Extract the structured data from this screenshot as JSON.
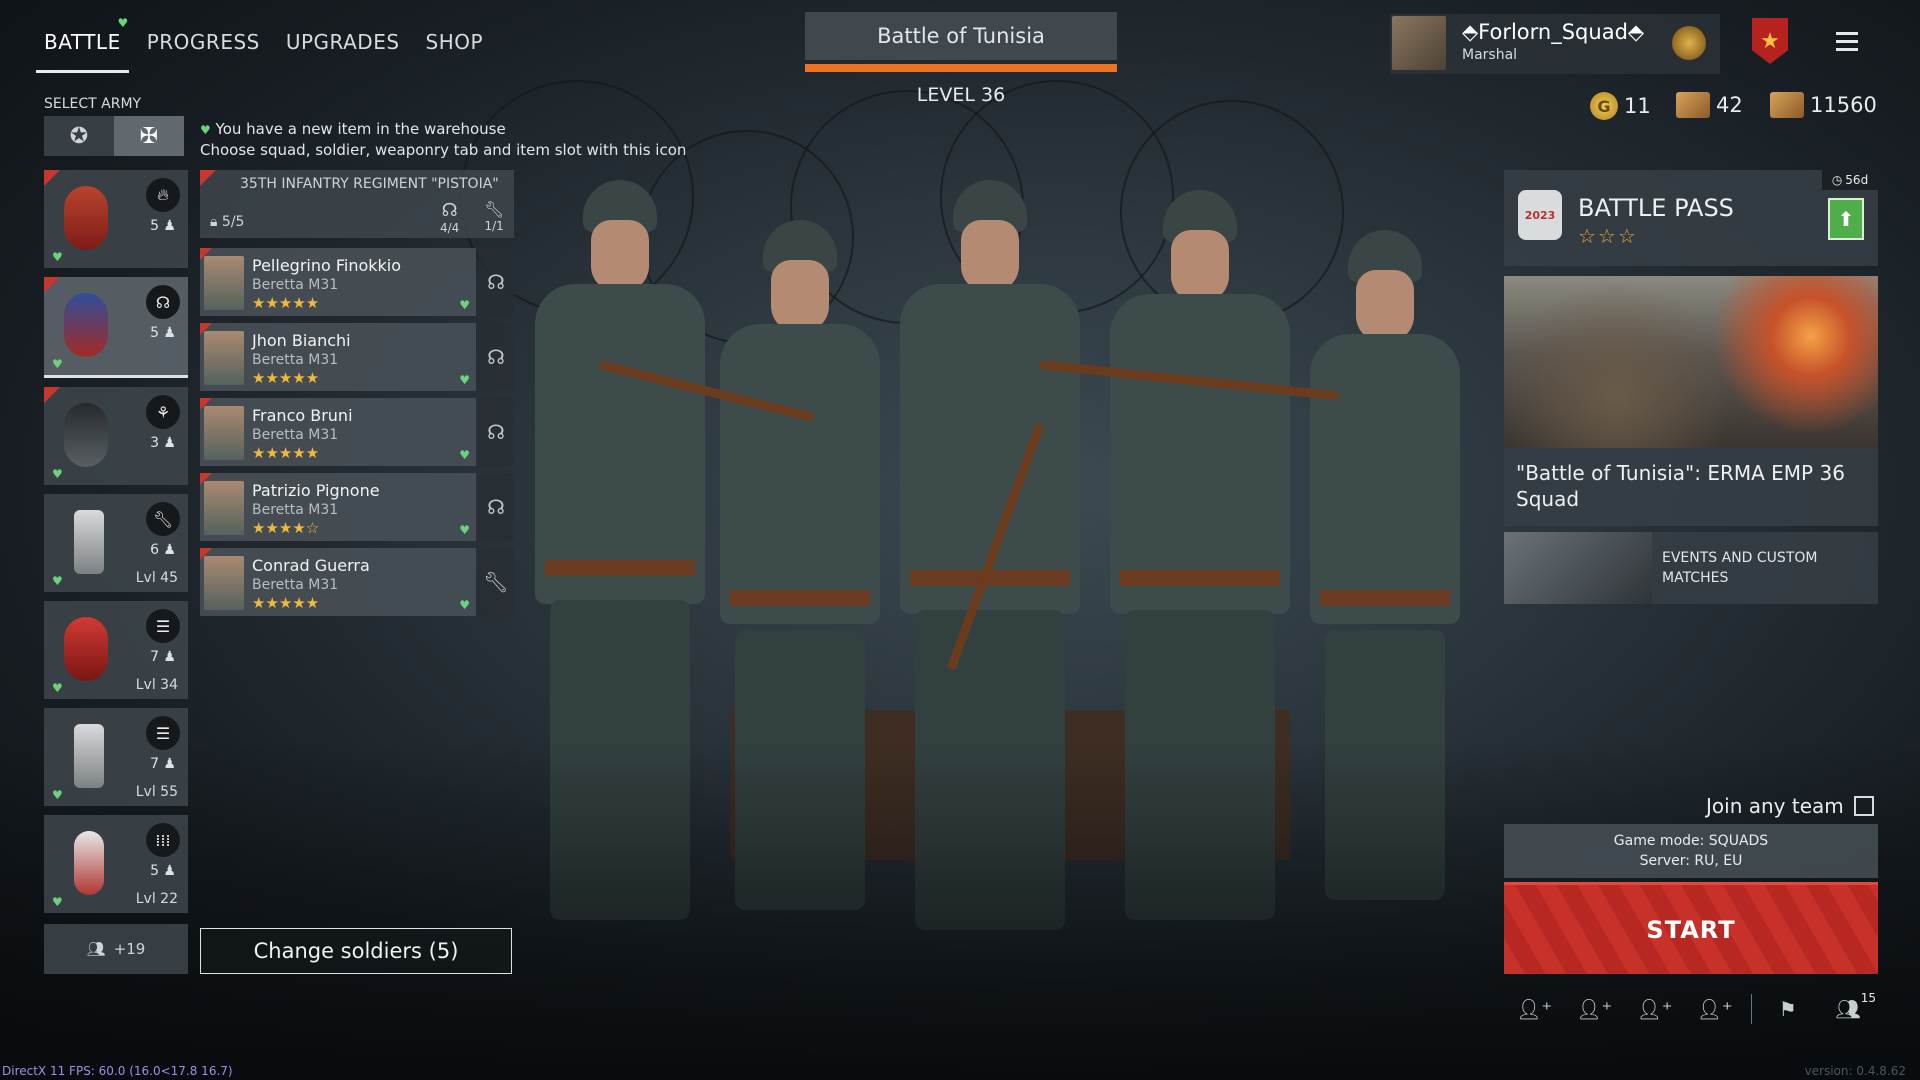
{
  "nav": {
    "tabs": [
      {
        "label": "BATTLE",
        "active": true
      },
      {
        "label": "PROGRESS",
        "active": false
      },
      {
        "label": "UPGRADES",
        "active": false
      },
      {
        "label": "SHOP",
        "active": false
      }
    ]
  },
  "battle": {
    "title": "Battle of Tunisia",
    "level": "LEVEL 36"
  },
  "profile": {
    "name": "Forlorn_Squad",
    "rank": "Marshal"
  },
  "currency": {
    "gold": "11",
    "tickets_a": "42",
    "tickets_b": "11560"
  },
  "army": {
    "label": "SELECT ARMY",
    "notice_line1": "You have a new item in the warehouse",
    "notice_line2": "Choose squad, soldier, weaponry tab and item slot with this icon"
  },
  "squads": [
    {
      "count": "5",
      "level": "",
      "type_icon": "fire-icon"
    },
    {
      "count": "5",
      "level": "",
      "type_icon": "headset-icon"
    },
    {
      "count": "3",
      "level": "",
      "type_icon": "paratrooper-icon"
    },
    {
      "count": "6",
      "level": "Lvl 45",
      "type_icon": "wrench-icon"
    },
    {
      "count": "7",
      "level": "Lvl 34",
      "type_icon": "list-icon"
    },
    {
      "count": "7",
      "level": "Lvl 55",
      "type_icon": "list-icon"
    },
    {
      "count": "5",
      "level": "Lvl 22",
      "type_icon": "ammo-icon"
    }
  ],
  "reserve": {
    "label": "+19"
  },
  "regiment": {
    "name": "35TH INFANTRY REGIMENT \"PISTOIA\"",
    "slots": "5/5",
    "radio_slots": "4/4",
    "engineer_slots": "1/1"
  },
  "soldiers": [
    {
      "name": "Pellegrino Finokkio",
      "weapon": "Beretta M31",
      "stars": "★★★★★",
      "side_icon": "headset-icon"
    },
    {
      "name": "Jhon Bianchi",
      "weapon": "Beretta M31",
      "stars": "★★★★★",
      "side_icon": "headset-icon"
    },
    {
      "name": "Franco Bruni",
      "weapon": "Beretta M31",
      "stars": "★★★★★",
      "side_icon": "headset-icon"
    },
    {
      "name": "Patrizio Pignone",
      "weapon": "Beretta M31",
      "stars": "★★★★☆",
      "side_icon": "headset-icon"
    },
    {
      "name": "Conrad Guerra",
      "weapon": "Beretta M31",
      "stars": "★★★★★",
      "side_icon": "wrench-icon"
    }
  ],
  "change_button": "Change soldiers (5)",
  "battle_pass": {
    "title": "BATTLE PASS",
    "logo": "2023",
    "timer": "56d",
    "stars": "☆☆☆"
  },
  "promo": {
    "title": "\"Battle of Tunisia\": ERMA EMP 36 Squad"
  },
  "events": {
    "label": "EVENTS AND CUSTOM MATCHES"
  },
  "join": {
    "label": "Join any team"
  },
  "mode": {
    "line1": "Game mode: SQUADS",
    "line2": "Server: RU, EU"
  },
  "start": {
    "label": "START"
  },
  "invite": {
    "squad_count": "15"
  },
  "footer": {
    "fps": "DirectX 11 FPS: 60.0 (16.0<17.8 16.7)",
    "version": "version: 0.4.8.62"
  },
  "colors": {
    "accent_orange": "#ec7322",
    "start_red": "#c8312a",
    "heart_green": "#6bd37a",
    "star_gold": "#f1b93b"
  }
}
